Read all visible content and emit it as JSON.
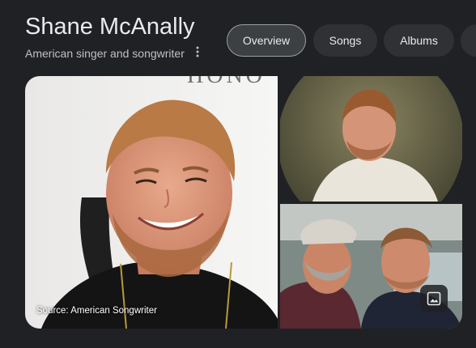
{
  "header": {
    "title": "Shane McAnally",
    "subtitle": "American singer and songwriter"
  },
  "tabs": [
    {
      "label": "Overview",
      "active": true
    },
    {
      "label": "Songs",
      "active": false
    },
    {
      "label": "Albums",
      "active": false
    }
  ],
  "images": {
    "main_source": "Source: American Songwriter",
    "main_backdrop_text": "HONO"
  },
  "icons": {
    "more": "more-vert-icon",
    "images": "image-icon"
  }
}
